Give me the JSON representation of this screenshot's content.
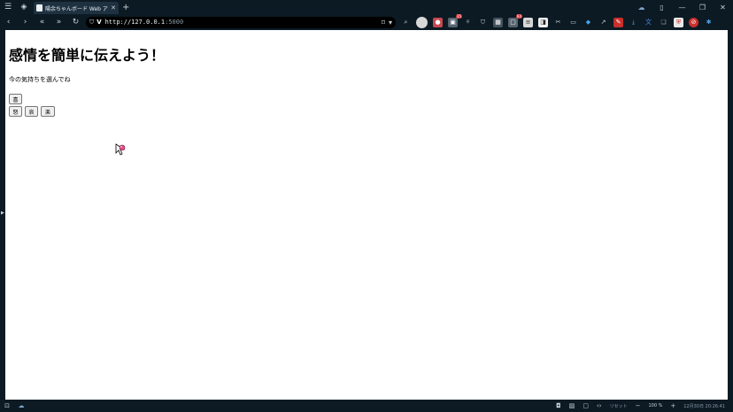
{
  "browser": {
    "tab_title": "陽余ちゃんボード Web ア",
    "url_host": "http://127.0.0.1",
    "url_port": ":5000",
    "browser_logo": "V"
  },
  "page": {
    "title": "感情を簡単に伝えよう！",
    "prompt": "今の気持ちを選んでね",
    "emotions": {
      "joy": "喜",
      "anger": "怒",
      "sorrow": "哀",
      "pleasure": "楽"
    }
  },
  "statusbar": {
    "reset_label": "リセット",
    "zoom": "100 %",
    "datetime": "12月30日 20:26:41"
  },
  "extensions": {
    "badge_1": "35",
    "badge_2": "64"
  }
}
